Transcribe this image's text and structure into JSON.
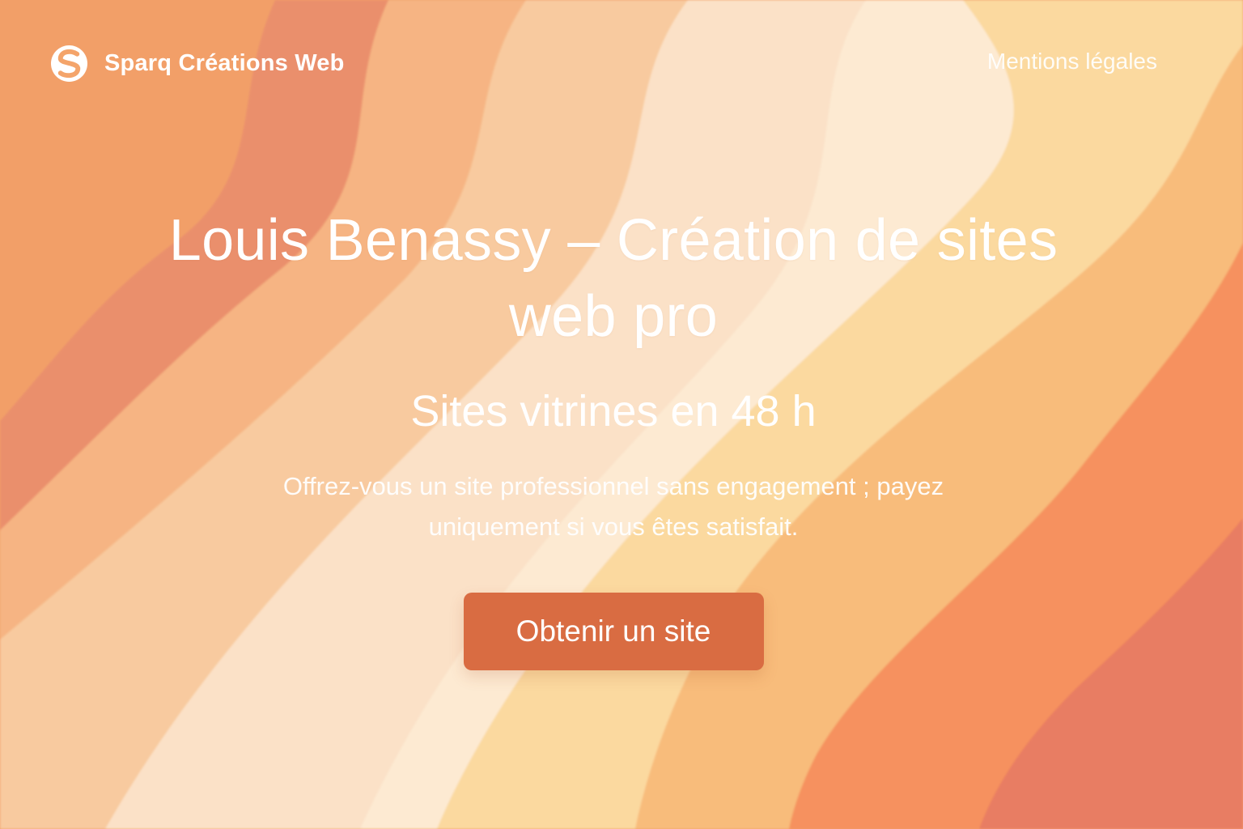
{
  "header": {
    "brand_name": "Sparq Créations Web",
    "logo_icon": "s-logo-icon",
    "nav": {
      "legal_label": "Mentions légales"
    }
  },
  "hero": {
    "title": "Louis Benassy – Création de sites web pro",
    "subtitle": "Sites vitrines en 48 h",
    "description": "Offrez-vous un site professionnel sans engagement ; payez uniquement si vous êtes satisfait.",
    "cta_label": "Obtenir un site"
  },
  "colors": {
    "accent": "#d96c42",
    "text": "#ffffff",
    "wave_palette": [
      "#f29a5f",
      "#e98963",
      "#f6b07c",
      "#f8c799",
      "#fbe0c4",
      "#fde9d0",
      "#fbd79a",
      "#f8b873",
      "#f68b55",
      "#e7745a"
    ]
  }
}
